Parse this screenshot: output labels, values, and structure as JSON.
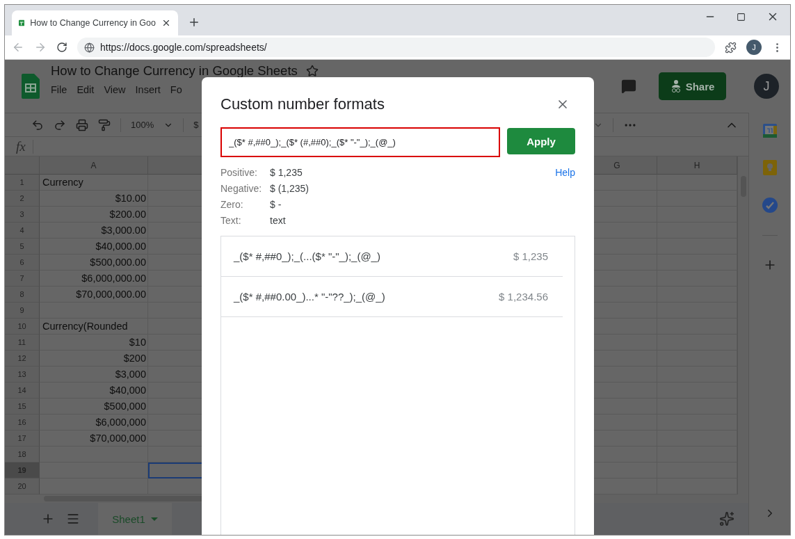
{
  "browser": {
    "tab_title": "How to Change Currency in Goo",
    "url": "https://docs.google.com/spreadsheets/",
    "profile": "J"
  },
  "doc": {
    "title": "How to Change Currency in Google Sheets",
    "menus": [
      "File",
      "Edit",
      "View",
      "Insert",
      "Fo"
    ],
    "share": "Share",
    "avatar": "J"
  },
  "toolbar": {
    "zoom": "100%",
    "currency": "$"
  },
  "formula_bar": {
    "fx": "fx"
  },
  "sheet": {
    "columns": [
      "A",
      "G",
      "H"
    ],
    "rows": [
      {
        "number": "1",
        "kind": "label",
        "a": "Currency",
        "selected": false
      },
      {
        "number": "2",
        "kind": "amount",
        "a": "$10.00",
        "selected": false
      },
      {
        "number": "3",
        "kind": "amount",
        "a": "$200.00",
        "selected": false
      },
      {
        "number": "4",
        "kind": "amount",
        "a": "$3,000.00",
        "selected": false
      },
      {
        "number": "5",
        "kind": "amount",
        "a": "$40,000.00",
        "selected": false
      },
      {
        "number": "6",
        "kind": "amount",
        "a": "$500,000.00",
        "selected": false
      },
      {
        "number": "7",
        "kind": "amount",
        "a": "$6,000,000.00",
        "selected": false
      },
      {
        "number": "8",
        "kind": "amount",
        "a": "$70,000,000.00",
        "selected": false
      },
      {
        "number": "9",
        "kind": "blank",
        "selected": false
      },
      {
        "number": "10",
        "kind": "label",
        "a": "Currency(Rounded",
        "selected": false
      },
      {
        "number": "11",
        "kind": "amount",
        "a": "$10",
        "selected": false
      },
      {
        "number": "12",
        "kind": "amount",
        "a": "$200",
        "selected": false
      },
      {
        "number": "13",
        "kind": "amount",
        "a": "$3,000",
        "selected": false
      },
      {
        "number": "14",
        "kind": "amount",
        "a": "$40,000",
        "selected": false
      },
      {
        "number": "15",
        "kind": "amount",
        "a": "$500,000",
        "selected": false
      },
      {
        "number": "16",
        "kind": "amount",
        "a": "$6,000,000",
        "selected": false
      },
      {
        "number": "17",
        "kind": "amount",
        "a": "$70,000,000",
        "selected": false
      },
      {
        "number": "18",
        "kind": "blank",
        "selected": false
      },
      {
        "number": "19",
        "kind": "blank",
        "selected": true
      },
      {
        "number": "20",
        "kind": "blank",
        "selected": false
      }
    ]
  },
  "sheet_tabs": [
    {
      "label": "Sheet1",
      "selected": true
    }
  ],
  "dialog": {
    "title": "Custom number formats",
    "format": "_($* #,##0_);_($* (#,##0);_($* \"-\"_);_(@_)",
    "apply": "Apply",
    "help": "Help",
    "preview": [
      {
        "label": "Positive:",
        "value": "$ 1,235"
      },
      {
        "label": "Negative:",
        "value": "$ (1,235)"
      },
      {
        "label": "Zero:",
        "value": "$ -"
      },
      {
        "label": "Text:",
        "value": "text"
      }
    ],
    "formats": [
      {
        "pattern": "_($* #,##0_);_(...($* \"-\"_);_(@_)",
        "example": "$ 1,235"
      },
      {
        "pattern": "_($* #,##0.00_)...* \"-\"??_);_(@_)",
        "example": "$ 1,234.56"
      }
    ]
  }
}
